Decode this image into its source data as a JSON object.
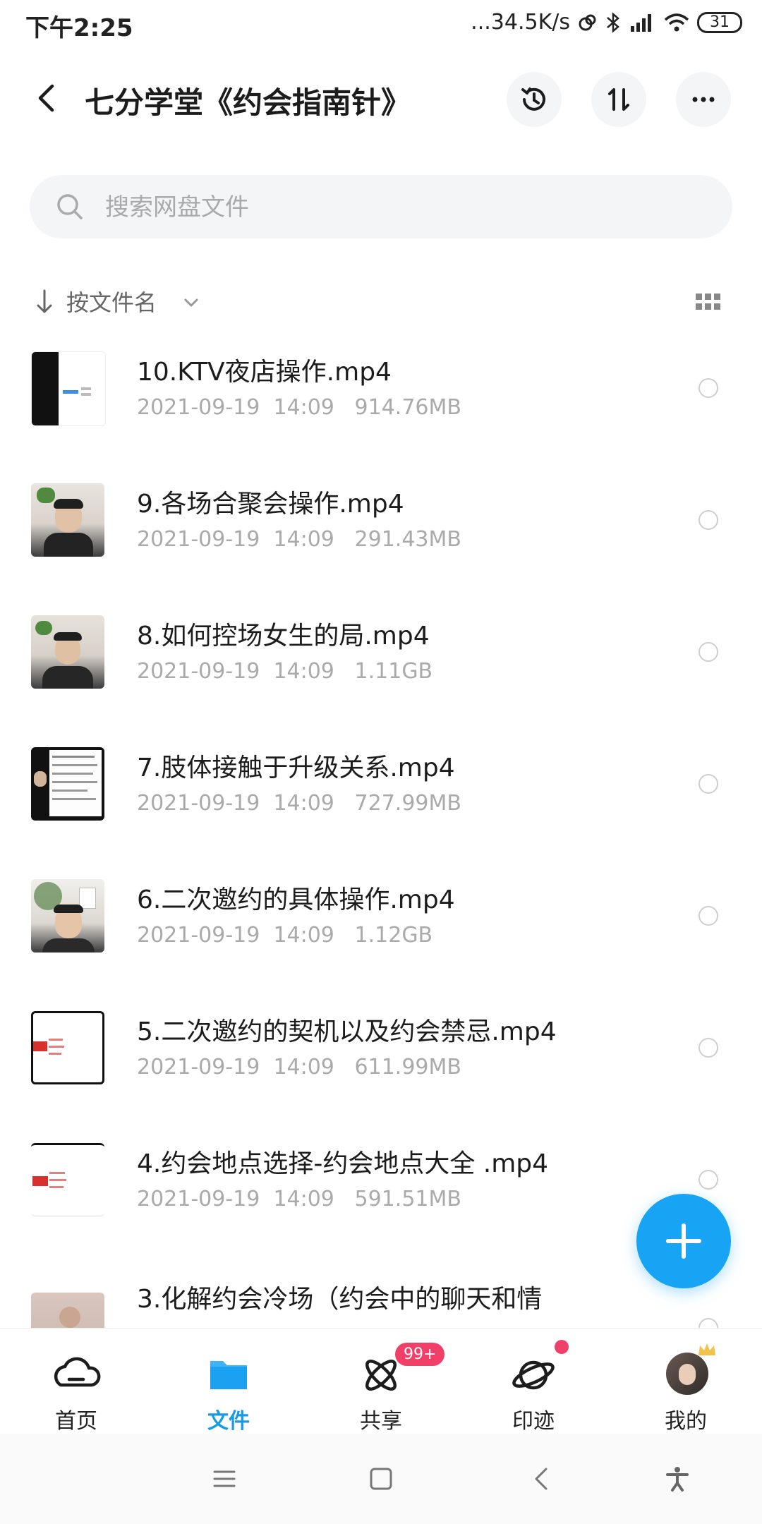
{
  "status_bar": {
    "time": "下午2:25",
    "network_speed": "...34.5K/s",
    "battery": "31"
  },
  "header": {
    "title": "七分学堂《约会指南针》"
  },
  "search": {
    "placeholder": "搜索网盘文件"
  },
  "sort": {
    "label": "按文件名"
  },
  "files": [
    {
      "name": "10.KTV夜店操作.mp4",
      "date": "2021-09-19",
      "time": "14:09",
      "size": "914.76MB"
    },
    {
      "name": "9.各场合聚会操作.mp4",
      "date": "2021-09-19",
      "time": "14:09",
      "size": "291.43MB"
    },
    {
      "name": "8.如何控场女生的局.mp4",
      "date": "2021-09-19",
      "time": "14:09",
      "size": "1.11GB"
    },
    {
      "name": "7.肢体接触于升级关系.mp4",
      "date": "2021-09-19",
      "time": "14:09",
      "size": "727.99MB"
    },
    {
      "name": "6.二次邀约的具体操作.mp4",
      "date": "2021-09-19",
      "time": "14:09",
      "size": "1.12GB"
    },
    {
      "name": "5.二次邀约的契机以及约会禁忌.mp4",
      "date": "2021-09-19",
      "time": "14:09",
      "size": "611.99MB"
    },
    {
      "name": "4.约会地点选择-约会地点大全 .mp4",
      "date": "2021-09-19",
      "time": "14:09",
      "size": "591.51MB"
    },
    {
      "name": "3.化解约会冷场（约会中的聊天和情",
      "date": "",
      "time": "",
      "size": ""
    }
  ],
  "bottom_nav": [
    {
      "label": "首页"
    },
    {
      "label": "文件"
    },
    {
      "label": "共享",
      "badge": "99+"
    },
    {
      "label": "印迹"
    },
    {
      "label": "我的"
    }
  ],
  "colors": {
    "accent": "#17a4f5",
    "active_tab": "#169be6",
    "badge": "#f0406a"
  }
}
